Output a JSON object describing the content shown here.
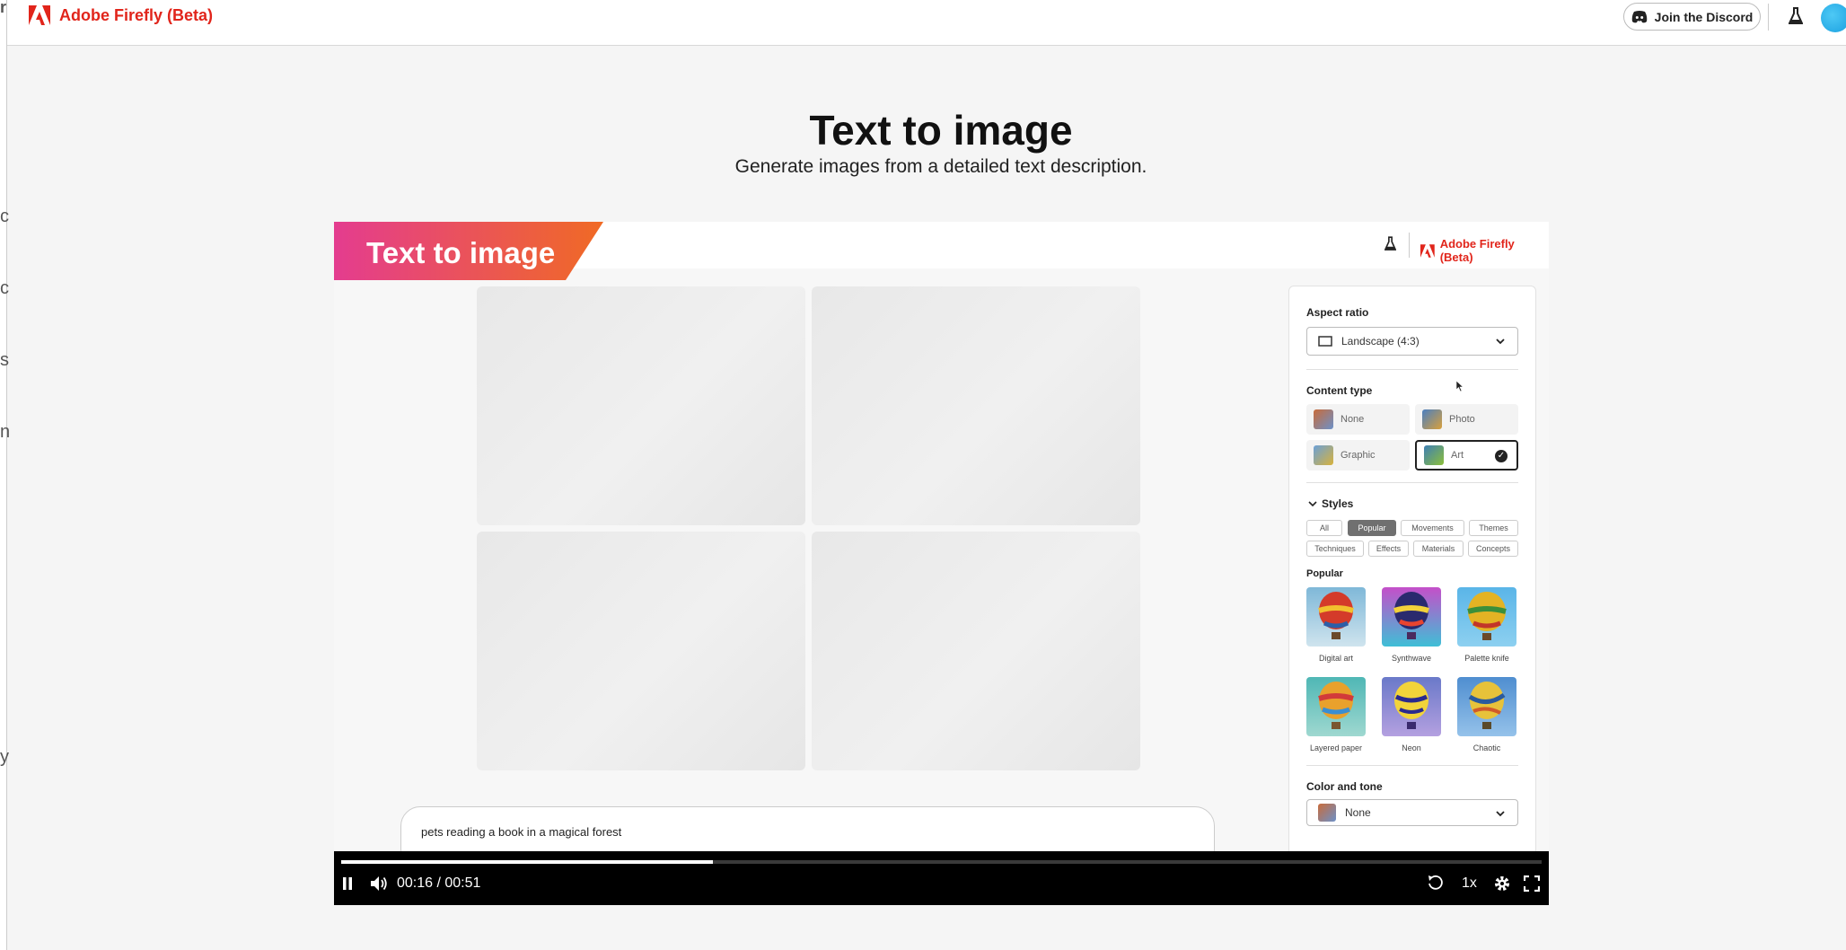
{
  "app": {
    "brand": "Adobe Firefly (Beta)",
    "discord_label": "Join the Discord"
  },
  "page": {
    "title": "Text to image",
    "subtitle": "Generate images from a detailed text description."
  },
  "video": {
    "banner_title": "Text to image",
    "inner_brand": "Adobe Firefly (Beta)",
    "panel": {
      "aspect_ratio_label": "Aspect ratio",
      "aspect_ratio_value": "Landscape (4:3)",
      "content_type_label": "Content type",
      "content_types": [
        {
          "label": "None",
          "selected": false
        },
        {
          "label": "Photo",
          "selected": false
        },
        {
          "label": "Graphic",
          "selected": false
        },
        {
          "label": "Art",
          "selected": true
        }
      ],
      "styles_label": "Styles",
      "style_chips": [
        {
          "label": "All",
          "active": false
        },
        {
          "label": "Popular",
          "active": true
        },
        {
          "label": "Movements",
          "active": false
        },
        {
          "label": "Themes",
          "active": false
        },
        {
          "label": "Techniques",
          "active": false
        },
        {
          "label": "Effects",
          "active": false
        },
        {
          "label": "Materials",
          "active": false
        },
        {
          "label": "Concepts",
          "active": false
        }
      ],
      "popular_label": "Popular",
      "styles": [
        {
          "label": "Digital art"
        },
        {
          "label": "Synthwave"
        },
        {
          "label": "Palette knife"
        },
        {
          "label": "Layered paper"
        },
        {
          "label": "Neon"
        },
        {
          "label": "Chaotic"
        }
      ],
      "color_tone_label": "Color and tone",
      "color_tone_value": "None"
    },
    "prompt_text": "pets reading a book in a magical forest",
    "player": {
      "time": "00:16 / 00:51",
      "speed": "1x",
      "progress": 0.31
    }
  },
  "left_edge_glyphs": [
    "r",
    "c",
    "c",
    "s",
    "n",
    "y"
  ]
}
